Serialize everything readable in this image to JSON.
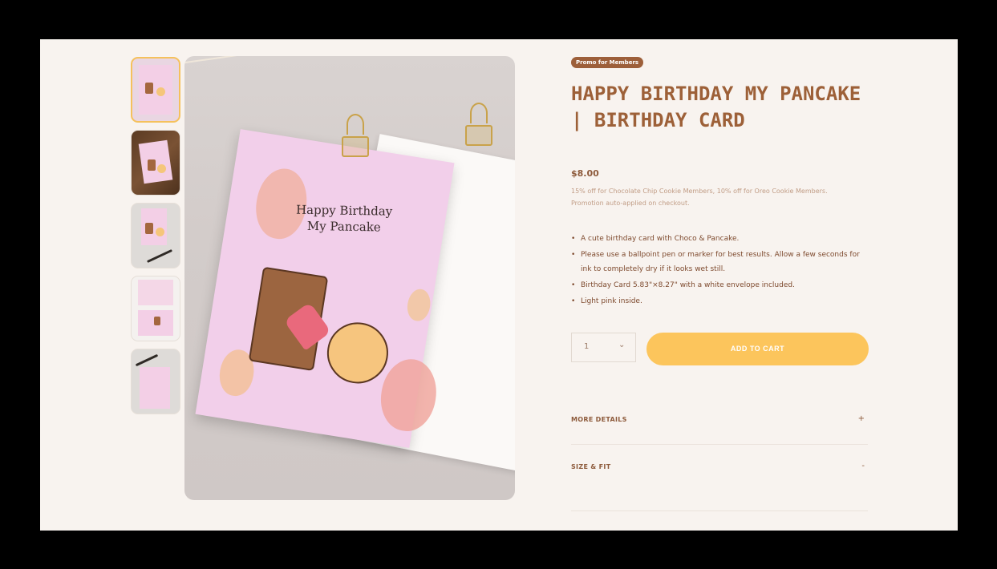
{
  "promo_badge": "Promo for Members",
  "title": "HAPPY BIRTHDAY MY PANCAKE | BIRTHDAY CARD",
  "price": "$8.00",
  "promo_note": "15% off for Chocolate Chip Cookie Members, 10% off for Oreo Cookie Members. Promotion auto-applied on checkout.",
  "features": [
    "A cute birthday card with Choco & Pancake.",
    "Please use a ballpoint pen or marker for best results. Allow a few seconds for ink to completely dry if it looks wet still.",
    "Birthday Card 5.83\"×8.27\" with a white envelope included.",
    "Light pink inside."
  ],
  "quantity": {
    "value": "1",
    "icon": "chevron-down-icon"
  },
  "add_to_cart": "ADD TO CART",
  "accordions": [
    {
      "label": "MORE DETAILS",
      "icon": "+"
    },
    {
      "label": "SIZE & FIT",
      "icon": "-"
    }
  ],
  "hero_card": {
    "line1": "Happy Birthday",
    "line2": "My Pancake"
  },
  "colors": {
    "accent": "#9d6038",
    "button": "#fcc55c",
    "badge": "#9d5f3a",
    "background": "#f8f3ef"
  }
}
